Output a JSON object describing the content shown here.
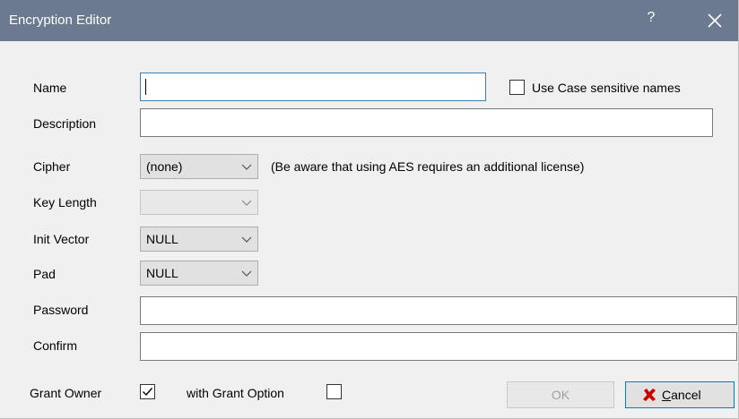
{
  "window": {
    "title": "Encryption Editor",
    "help_glyph": "?",
    "close_icon": "close-icon"
  },
  "form": {
    "name_label": "Name",
    "name_value": "",
    "case_sensitive_label": "Use Case sensitive names",
    "case_sensitive_checked": false,
    "description_label": "Description",
    "description_value": "",
    "cipher_label": "Cipher",
    "cipher_value": "(none)",
    "cipher_note": "(Be aware that using AES requires an additional license)",
    "key_length_label": "Key Length",
    "key_length_value": "",
    "init_vector_label": "Init Vector",
    "init_vector_value": "NULL",
    "pad_label": "Pad",
    "pad_value": "NULL",
    "password_label": "Password",
    "password_value": "",
    "confirm_label": "Confirm",
    "confirm_value": "",
    "grant_owner_label": "Grant Owner",
    "grant_owner_checked": true,
    "grant_option_label": "with Grant Option",
    "grant_option_checked": false
  },
  "buttons": {
    "ok_label": "OK",
    "cancel_label": "Cancel"
  },
  "colors": {
    "titlebar": "#6b7a8e",
    "focus_border": "#3c7fb1",
    "cancel_icon": "#cc0000"
  }
}
